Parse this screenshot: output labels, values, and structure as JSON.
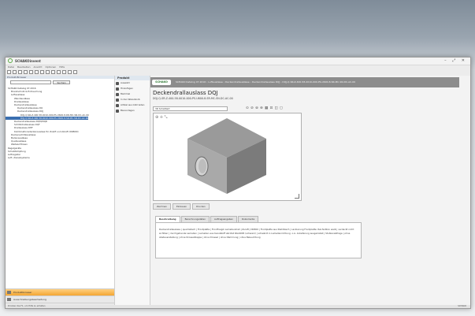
{
  "app": {
    "title": "SCHAKOinvent",
    "window_controls": "– ⤢ ✕"
  },
  "menu": [
    "Datei",
    "Bearbeiten",
    "Ansicht",
    "Optionen",
    "Hilfe"
  ],
  "left_pane": {
    "header": "Produkt-Browser",
    "search_button": "Suchen",
    "tree": [
      {
        "label": "SCHAKO Katalog 07.2016",
        "indent": 0,
        "selected": false
      },
      {
        "label": "Brandschutz & Entrauchung",
        "indent": 1,
        "selected": false
      },
      {
        "label": "Luftauslässe",
        "indent": 1,
        "selected": false
      },
      {
        "label": "Wandauslässe",
        "indent": 2,
        "selected": false
      },
      {
        "label": "Drallauslässe",
        "indent": 2,
        "selected": false
      },
      {
        "label": "Deckendrallauslässe",
        "indent": 2,
        "selected": false
      },
      {
        "label": "Deckendrallauslass DQ",
        "indent": 3,
        "selected": false
      },
      {
        "label": "Deckendrallauslass DQJ",
        "indent": 3,
        "selected": false
      },
      {
        "label": "DQJ-Q-SR-Z-400-58-0010-000-PS-U600-8-DR-MC-SN-DC-AC-00",
        "indent": 4,
        "selected": false
      },
      {
        "label": "DQJ-Q-SR-Z-400-58-0010-000-PS-U600-8-SR-MC-SN-DC-AC-00",
        "indent": 4,
        "selected": true
      },
      {
        "label": "Deckendrallauslass DQM/DQR",
        "indent": 2,
        "selected": false
      },
      {
        "label": "Schlitzdrallauslass DQF",
        "indent": 2,
        "selected": false
      },
      {
        "label": "Drallauslass DHF",
        "indent": 2,
        "selected": false
      },
      {
        "label": "Kombinationsdeckenauslass für Zuluft und Abluft (DKBD0)",
        "indent": 2,
        "selected": false
      },
      {
        "label": "Deckenschlitzauslässe",
        "indent": 1,
        "selected": false
      },
      {
        "label": "Bodenauslässe",
        "indent": 1,
        "selected": false
      },
      {
        "label": "Quellauslässe",
        "indent": 1,
        "selected": false
      },
      {
        "label": "Weitwurfdüsen",
        "indent": 1,
        "selected": false
      },
      {
        "label": "Regelgeräte",
        "indent": 0,
        "selected": false
      },
      {
        "label": "Schalldämpfung",
        "indent": 0,
        "selected": false
      },
      {
        "label": "Luftregister",
        "indent": 0,
        "selected": false
      },
      {
        "label": "Luft- /Kanalsysteme",
        "indent": 0,
        "selected": false
      }
    ],
    "sections": [
      {
        "label": "Produktbrowser",
        "active": true
      },
      {
        "label": "Ausschreibungsbearbeitung",
        "active": false
      },
      {
        "label": "Projektdaten",
        "active": false
      }
    ]
  },
  "actions": {
    "header": "Produkt",
    "items": [
      "Auswahl",
      "Hinzufügen",
      "Merkmal",
      "In den Warenkorb",
      "Artikel aus CAD laden",
      "Bauvorlagen"
    ]
  },
  "content": {
    "breadcrumb": "SCHAKO Katalog 07.2016 › Luftauslässe › Deckendrallauslässe › Deckendrallauslass DQJ › DQJ-Q-SR-Z-400-58-0010-000-PS-U600-8-SR-MC-SN-DC-AC-00",
    "logo": "SCHAKO",
    "product_title": "Deckendrallauslass DQJ",
    "product_code": "DQJ-Q-SR-Z-400-58-0010-000-PS-U600-8-SR-MC-SN-DC-AC-00",
    "view_select": "3D Schattiert",
    "view_icons": "⊙ ⊘ ⊚ ⊛ ▦ ⊡ ◫ ◻",
    "viewer_tools": "⊕ ✛ ⤡",
    "subtabs": [
      "Zeichnen",
      "Einbauen",
      "Drucken"
    ],
    "tabs": [
      "Beschreibung",
      "Berechnungsdaten",
      "Auftragsangaben",
      "Dokumente"
    ],
    "description": "Deckendrallauslass | quadratisch | Frontplatte | Frontfreigöi Lamellendrall | Zuluft | DN300 | Frontplatte aus Stahlblech | Lackierung Frontplatte: Ral-farbton weiß | verdeckt nicht sichtbar | durchgehende Lamellen | Lamellen aus Kunststoff abrütst RAL9005 (schwarz) | schwärzt in Lamellenrichtung  o.A. Anlieferung ausgerüstet | Stutzenabfrage | ohne Absteuerstellung | ohne Drosselklappe | ohne Drossel | ohne Dämmung | ohne Beleuchtung"
  },
  "status": {
    "left": "Drücken Sie F1, um Hilfe zu erhalten",
    "right": "SCHAKO"
  }
}
